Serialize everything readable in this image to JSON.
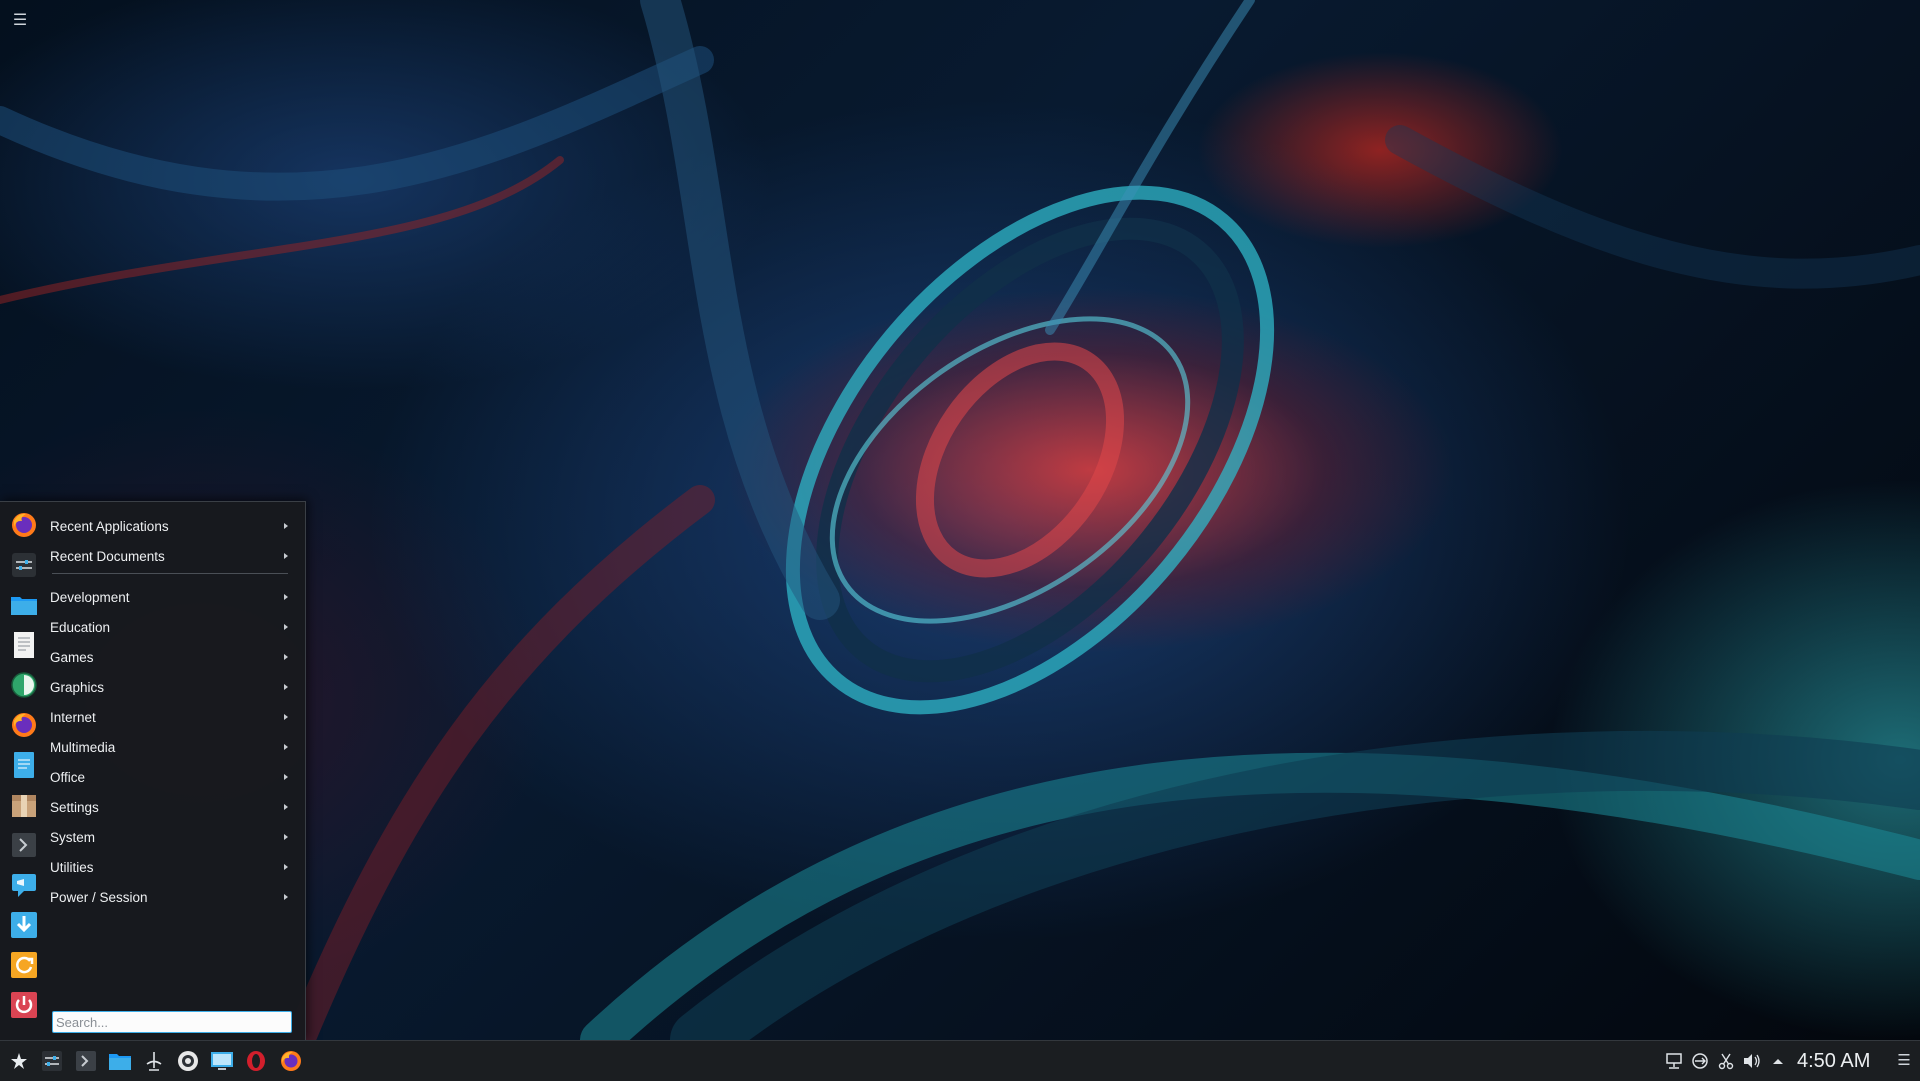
{
  "desktop": {
    "menu_icon": "hamburger-icon"
  },
  "app_menu": {
    "items": [
      {
        "label": "Recent Applications",
        "icon": "firefox-icon"
      },
      {
        "label": "Recent Documents",
        "icon": "settings-sliders-icon"
      },
      {
        "label": "Development",
        "icon": "folder-icon"
      },
      {
        "label": "Education",
        "icon": "document-icon"
      },
      {
        "label": "Games",
        "icon": "globe-icon"
      },
      {
        "label": "Graphics",
        "icon": "firefox-icon"
      },
      {
        "label": "Internet",
        "icon": "text-document-icon"
      },
      {
        "label": "Multimedia",
        "icon": "package-icon"
      },
      {
        "label": "Office",
        "icon": "terminal-icon"
      },
      {
        "label": "Settings",
        "icon": "chat-icon"
      },
      {
        "label": "System",
        "icon": "download-icon"
      },
      {
        "label": "Utilities",
        "icon": "refresh-icon"
      },
      {
        "label": "Power / Session",
        "icon": "power-icon"
      }
    ],
    "search": {
      "placeholder": "Search...",
      "value": ""
    }
  },
  "taskbar": {
    "launchers": [
      "app-launcher-icon",
      "settings-sliders-icon",
      "terminal-icon",
      "folder-icon",
      "kde-connect-icon",
      "weather-icon",
      "screen-icon",
      "opera-icon",
      "firefox-icon"
    ],
    "tray": [
      "network-icon",
      "vpn-icon",
      "scissors-icon",
      "volume-icon",
      "tray-expand-icon"
    ],
    "clock": "4:50 AM",
    "menu_icon": "hamburger-icon"
  },
  "colors": {
    "accent": "#3daee9",
    "menu_bg": "#181a1e",
    "taskbar_bg": "#1b1e21"
  }
}
